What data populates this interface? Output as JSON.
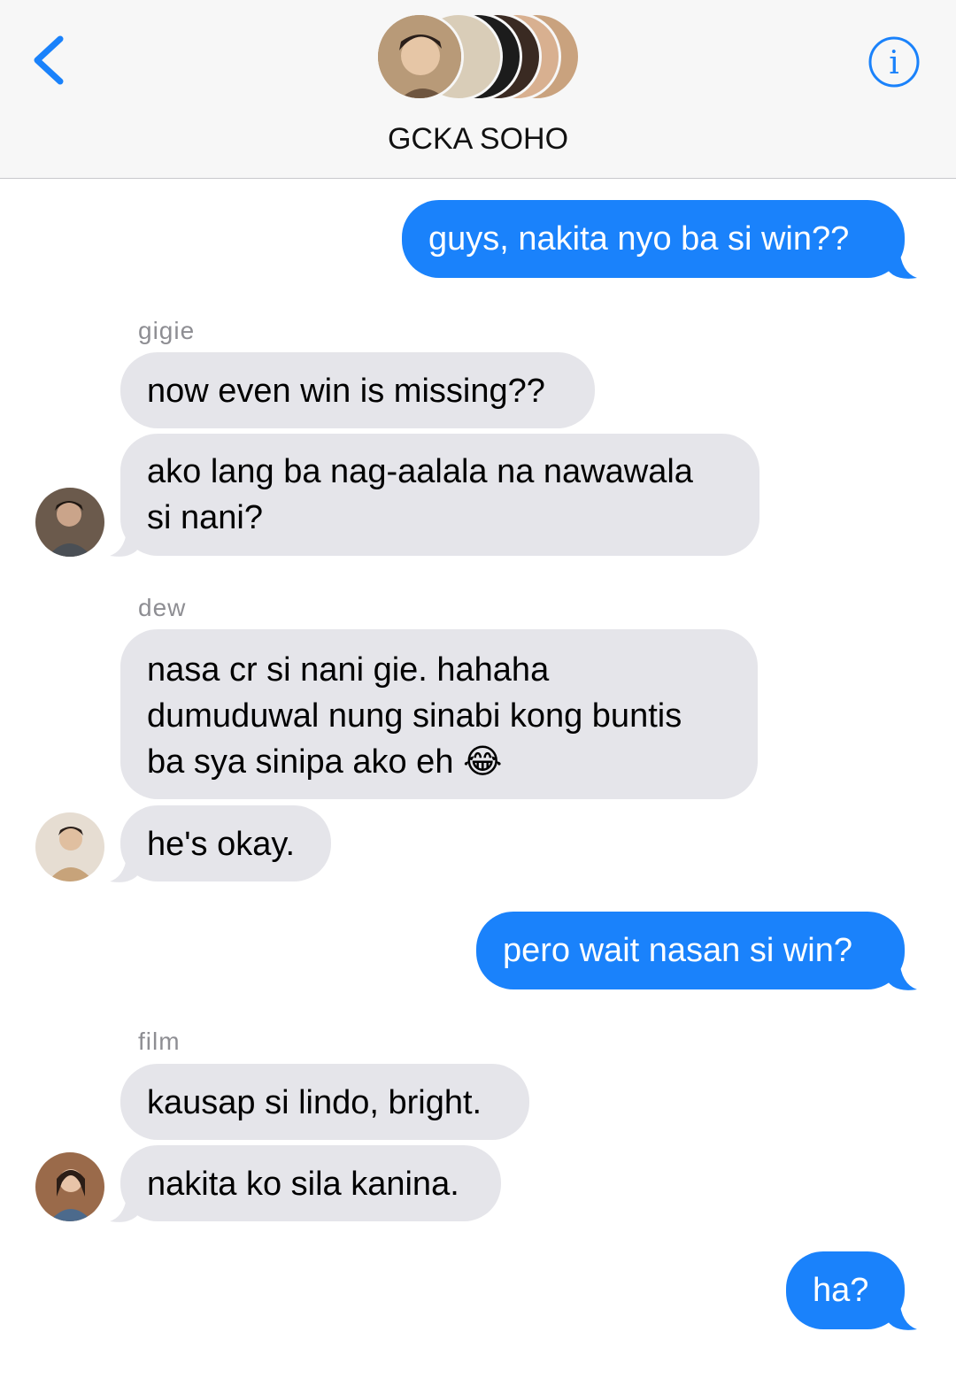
{
  "header": {
    "title": "GCKA SOHO",
    "back_icon": "chevron-left-icon",
    "info_icon": "info-icon",
    "accent": "#1a82fb"
  },
  "messages": [
    {
      "dir": "out",
      "text": "guys, nakita nyo ba si win??"
    },
    {
      "dir": "in",
      "sender": "gigie",
      "text": "now even win is missing??"
    },
    {
      "dir": "in",
      "text_lines": [
        "ako lang ba nag-aalala na nawawala",
        "si nani?"
      ]
    },
    {
      "dir": "in",
      "sender": "dew",
      "text_lines": [
        "nasa cr si nani gie. hahaha",
        "dumuduwal nung sinabi kong buntis",
        "ba sya sinipa ako eh 😂"
      ]
    },
    {
      "dir": "in",
      "text": "he's okay."
    },
    {
      "dir": "out",
      "text": "pero wait nasan si win?"
    },
    {
      "dir": "in",
      "sender": "film",
      "text": "kausap si lindo, bright."
    },
    {
      "dir": "in",
      "text": "nakita ko sila kanina."
    },
    {
      "dir": "out",
      "text": "ha?"
    }
  ],
  "colors": {
    "outgoing_bubble": "#1a82fb",
    "incoming_bubble": "#e5e5ea",
    "sender_label": "#8e8e93"
  }
}
